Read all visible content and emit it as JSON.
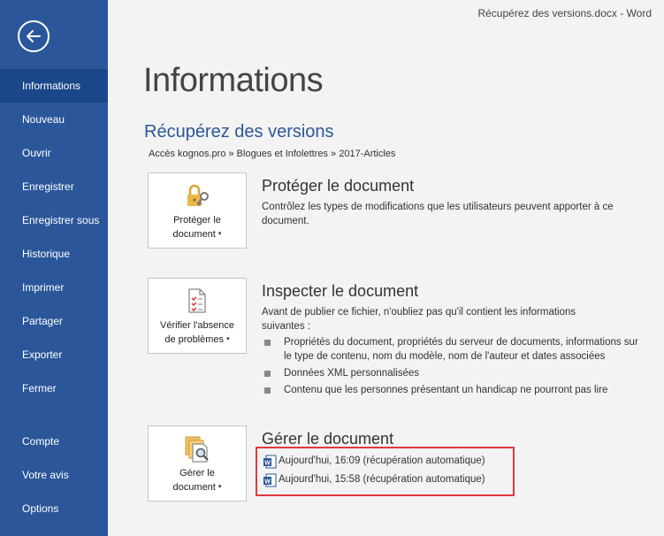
{
  "window": {
    "title": "Récupérez des versions.docx  -  Word"
  },
  "sidebar": {
    "back_icon": "back-arrow-icon",
    "items": [
      {
        "label": "Informations",
        "active": true
      },
      {
        "label": "Nouveau"
      },
      {
        "label": "Ouvrir"
      },
      {
        "label": "Enregistrer"
      },
      {
        "label": "Enregistrer sous"
      },
      {
        "label": "Historique"
      },
      {
        "label": "Imprimer"
      },
      {
        "label": "Partager"
      },
      {
        "label": "Exporter"
      },
      {
        "label": "Fermer"
      },
      {
        "label": "Compte"
      },
      {
        "label": "Votre avis"
      },
      {
        "label": "Options"
      }
    ]
  },
  "main": {
    "title": "Informations",
    "document_name": "Récupérez des versions",
    "breadcrumb": "Accès kognos.pro » Blogues et Infolettres » 2017-Articles",
    "sections": [
      {
        "button_line1": "Protéger le",
        "button_line2": "document",
        "icon": "lock-key-icon",
        "title": "Protéger le document",
        "description": "Contrôlez les types de modifications que les utilisateurs peuvent apporter à ce document."
      },
      {
        "button_line1": "Vérifier l'absence",
        "button_line2": "de problèmes",
        "icon": "checklist-icon",
        "title": "Inspecter le document",
        "description": "Avant de publier ce fichier, n'oubliez pas qu'il contient les informations suivantes :",
        "bullets": [
          "Propriétés du document, propriétés du serveur de documents, informations sur le type de contenu, nom du modèle, nom de l'auteur et dates associées",
          "Données XML personnalisées",
          "Contenu que les personnes présentant un handicap ne pourront pas lire"
        ]
      },
      {
        "button_line1": "Gérer le",
        "button_line2": "document",
        "icon": "manage-document-icon",
        "title": "Gérer le document",
        "versions": [
          "Aujourd'hui, 16:09 (récupération automatique)",
          "Aujourd'hui, 15:58 (récupération automatique)"
        ]
      }
    ]
  },
  "colors": {
    "sidebar": "#2b579a",
    "sidebar_active": "#19478a",
    "accent": "#2b579a",
    "highlight_border": "#e0393e"
  }
}
